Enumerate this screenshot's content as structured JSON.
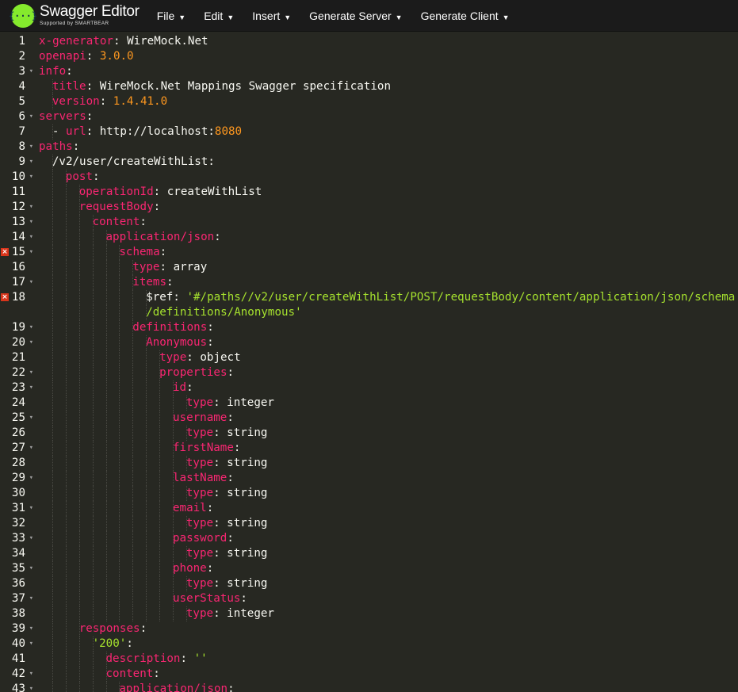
{
  "header": {
    "logo_title": "Swagger Editor",
    "logo_subtitle": "Supported by SMARTBEAR",
    "logo_icon": "{···}",
    "menu": [
      {
        "label": "File",
        "caret": "▼"
      },
      {
        "label": "Edit",
        "caret": "▼"
      },
      {
        "label": "Insert",
        "caret": "▼"
      },
      {
        "label": "Generate Server",
        "caret": "▼"
      },
      {
        "label": "Generate Client",
        "caret": "▼"
      }
    ]
  },
  "colors": {
    "accent": "#85ea2d",
    "key": "#f92672",
    "number": "#fd971f",
    "string": "#a6e22e",
    "text": "#f8f8f2",
    "error": "#d9351b"
  },
  "editor": {
    "lines": [
      {
        "n": "1",
        "fold": "",
        "err": false,
        "ind": 0,
        "tokens": [
          {
            "t": "k",
            "v": "x-generator"
          },
          {
            "t": "p",
            "v": ": "
          },
          {
            "t": "v",
            "v": "WireMock.Net"
          }
        ]
      },
      {
        "n": "2",
        "fold": "",
        "err": false,
        "ind": 0,
        "tokens": [
          {
            "t": "k",
            "v": "openapi"
          },
          {
            "t": "p",
            "v": ": "
          },
          {
            "t": "n",
            "v": "3.0.0"
          }
        ]
      },
      {
        "n": "3",
        "fold": "▾",
        "err": false,
        "ind": 0,
        "tokens": [
          {
            "t": "k",
            "v": "info"
          },
          {
            "t": "p",
            "v": ":"
          }
        ]
      },
      {
        "n": "4",
        "fold": "",
        "err": false,
        "ind": 1,
        "tokens": [
          {
            "t": "k",
            "v": "title"
          },
          {
            "t": "p",
            "v": ": "
          },
          {
            "t": "v",
            "v": "WireMock.Net Mappings Swagger specification"
          }
        ]
      },
      {
        "n": "5",
        "fold": "",
        "err": false,
        "ind": 1,
        "tokens": [
          {
            "t": "k",
            "v": "version"
          },
          {
            "t": "p",
            "v": ": "
          },
          {
            "t": "n",
            "v": "1.4.41.0"
          }
        ]
      },
      {
        "n": "6",
        "fold": "▾",
        "err": false,
        "ind": 0,
        "tokens": [
          {
            "t": "k",
            "v": "servers"
          },
          {
            "t": "p",
            "v": ":"
          }
        ]
      },
      {
        "n": "7",
        "fold": "",
        "err": false,
        "ind": 1,
        "tokens": [
          {
            "t": "p",
            "v": "- "
          },
          {
            "t": "k",
            "v": "url"
          },
          {
            "t": "p",
            "v": ": "
          },
          {
            "t": "v",
            "v": "http://localhost:"
          },
          {
            "t": "n",
            "v": "8080"
          }
        ]
      },
      {
        "n": "8",
        "fold": "▾",
        "err": false,
        "ind": 0,
        "tokens": [
          {
            "t": "k",
            "v": "paths"
          },
          {
            "t": "p",
            "v": ":"
          }
        ]
      },
      {
        "n": "9",
        "fold": "▾",
        "err": false,
        "ind": 1,
        "tokens": [
          {
            "t": "v",
            "v": "/v2/user/createWithList"
          },
          {
            "t": "p",
            "v": ":"
          }
        ]
      },
      {
        "n": "10",
        "fold": "▾",
        "err": false,
        "ind": 2,
        "tokens": [
          {
            "t": "k",
            "v": "post"
          },
          {
            "t": "p",
            "v": ":"
          }
        ]
      },
      {
        "n": "11",
        "fold": "",
        "err": false,
        "ind": 3,
        "tokens": [
          {
            "t": "k",
            "v": "operationId"
          },
          {
            "t": "p",
            "v": ": "
          },
          {
            "t": "v",
            "v": "createWithList"
          }
        ]
      },
      {
        "n": "12",
        "fold": "▾",
        "err": false,
        "ind": 3,
        "tokens": [
          {
            "t": "k",
            "v": "requestBody"
          },
          {
            "t": "p",
            "v": ":"
          }
        ]
      },
      {
        "n": "13",
        "fold": "▾",
        "err": false,
        "ind": 4,
        "tokens": [
          {
            "t": "k",
            "v": "content"
          },
          {
            "t": "p",
            "v": ":"
          }
        ]
      },
      {
        "n": "14",
        "fold": "▾",
        "err": false,
        "ind": 5,
        "tokens": [
          {
            "t": "k",
            "v": "application/json"
          },
          {
            "t": "p",
            "v": ":"
          }
        ]
      },
      {
        "n": "15",
        "fold": "▾",
        "err": true,
        "ind": 6,
        "tokens": [
          {
            "t": "k",
            "v": "schema"
          },
          {
            "t": "p",
            "v": ":"
          }
        ]
      },
      {
        "n": "16",
        "fold": "",
        "err": false,
        "ind": 7,
        "tokens": [
          {
            "t": "k",
            "v": "type"
          },
          {
            "t": "p",
            "v": ": "
          },
          {
            "t": "v",
            "v": "array"
          }
        ]
      },
      {
        "n": "17",
        "fold": "▾",
        "err": false,
        "ind": 7,
        "tokens": [
          {
            "t": "k",
            "v": "items"
          },
          {
            "t": "p",
            "v": ":"
          }
        ]
      },
      {
        "n": "18",
        "fold": "",
        "err": true,
        "ind": 8,
        "tokens": [
          {
            "t": "v",
            "v": "$ref"
          },
          {
            "t": "p",
            "v": ": "
          },
          {
            "t": "s",
            "v": "'#/paths//v2/user/createWithList/POST/requestBody/content/application/json/schema"
          }
        ]
      },
      {
        "n": "",
        "fold": "",
        "err": false,
        "ind": 8,
        "wrap": true,
        "tokens": [
          {
            "t": "s",
            "v": "/definitions/Anonymous'"
          }
        ]
      },
      {
        "n": "19",
        "fold": "▾",
        "err": false,
        "ind": 7,
        "tokens": [
          {
            "t": "k",
            "v": "definitions"
          },
          {
            "t": "p",
            "v": ":"
          }
        ]
      },
      {
        "n": "20",
        "fold": "▾",
        "err": false,
        "ind": 8,
        "tokens": [
          {
            "t": "k",
            "v": "Anonymous"
          },
          {
            "t": "p",
            "v": ":"
          }
        ]
      },
      {
        "n": "21",
        "fold": "",
        "err": false,
        "ind": 9,
        "tokens": [
          {
            "t": "k",
            "v": "type"
          },
          {
            "t": "p",
            "v": ": "
          },
          {
            "t": "v",
            "v": "object"
          }
        ]
      },
      {
        "n": "22",
        "fold": "▾",
        "err": false,
        "ind": 9,
        "tokens": [
          {
            "t": "k",
            "v": "properties"
          },
          {
            "t": "p",
            "v": ":"
          }
        ]
      },
      {
        "n": "23",
        "fold": "▾",
        "err": false,
        "ind": 10,
        "tokens": [
          {
            "t": "k",
            "v": "id"
          },
          {
            "t": "p",
            "v": ":"
          }
        ]
      },
      {
        "n": "24",
        "fold": "",
        "err": false,
        "ind": 11,
        "tokens": [
          {
            "t": "k",
            "v": "type"
          },
          {
            "t": "p",
            "v": ": "
          },
          {
            "t": "v",
            "v": "integer"
          }
        ]
      },
      {
        "n": "25",
        "fold": "▾",
        "err": false,
        "ind": 10,
        "tokens": [
          {
            "t": "k",
            "v": "username"
          },
          {
            "t": "p",
            "v": ":"
          }
        ]
      },
      {
        "n": "26",
        "fold": "",
        "err": false,
        "ind": 11,
        "tokens": [
          {
            "t": "k",
            "v": "type"
          },
          {
            "t": "p",
            "v": ": "
          },
          {
            "t": "v",
            "v": "string"
          }
        ]
      },
      {
        "n": "27",
        "fold": "▾",
        "err": false,
        "ind": 10,
        "tokens": [
          {
            "t": "k",
            "v": "firstName"
          },
          {
            "t": "p",
            "v": ":"
          }
        ]
      },
      {
        "n": "28",
        "fold": "",
        "err": false,
        "ind": 11,
        "tokens": [
          {
            "t": "k",
            "v": "type"
          },
          {
            "t": "p",
            "v": ": "
          },
          {
            "t": "v",
            "v": "string"
          }
        ]
      },
      {
        "n": "29",
        "fold": "▾",
        "err": false,
        "ind": 10,
        "tokens": [
          {
            "t": "k",
            "v": "lastName"
          },
          {
            "t": "p",
            "v": ":"
          }
        ]
      },
      {
        "n": "30",
        "fold": "",
        "err": false,
        "ind": 11,
        "tokens": [
          {
            "t": "k",
            "v": "type"
          },
          {
            "t": "p",
            "v": ": "
          },
          {
            "t": "v",
            "v": "string"
          }
        ]
      },
      {
        "n": "31",
        "fold": "▾",
        "err": false,
        "ind": 10,
        "tokens": [
          {
            "t": "k",
            "v": "email"
          },
          {
            "t": "p",
            "v": ":"
          }
        ]
      },
      {
        "n": "32",
        "fold": "",
        "err": false,
        "ind": 11,
        "tokens": [
          {
            "t": "k",
            "v": "type"
          },
          {
            "t": "p",
            "v": ": "
          },
          {
            "t": "v",
            "v": "string"
          }
        ]
      },
      {
        "n": "33",
        "fold": "▾",
        "err": false,
        "ind": 10,
        "tokens": [
          {
            "t": "k",
            "v": "password"
          },
          {
            "t": "p",
            "v": ":"
          }
        ]
      },
      {
        "n": "34",
        "fold": "",
        "err": false,
        "ind": 11,
        "tokens": [
          {
            "t": "k",
            "v": "type"
          },
          {
            "t": "p",
            "v": ": "
          },
          {
            "t": "v",
            "v": "string"
          }
        ]
      },
      {
        "n": "35",
        "fold": "▾",
        "err": false,
        "ind": 10,
        "tokens": [
          {
            "t": "k",
            "v": "phone"
          },
          {
            "t": "p",
            "v": ":"
          }
        ]
      },
      {
        "n": "36",
        "fold": "",
        "err": false,
        "ind": 11,
        "tokens": [
          {
            "t": "k",
            "v": "type"
          },
          {
            "t": "p",
            "v": ": "
          },
          {
            "t": "v",
            "v": "string"
          }
        ]
      },
      {
        "n": "37",
        "fold": "▾",
        "err": false,
        "ind": 10,
        "tokens": [
          {
            "t": "k",
            "v": "userStatus"
          },
          {
            "t": "p",
            "v": ":"
          }
        ]
      },
      {
        "n": "38",
        "fold": "",
        "err": false,
        "ind": 11,
        "tokens": [
          {
            "t": "k",
            "v": "type"
          },
          {
            "t": "p",
            "v": ": "
          },
          {
            "t": "v",
            "v": "integer"
          }
        ]
      },
      {
        "n": "39",
        "fold": "▾",
        "err": false,
        "ind": 3,
        "tokens": [
          {
            "t": "k",
            "v": "responses"
          },
          {
            "t": "p",
            "v": ":"
          }
        ]
      },
      {
        "n": "40",
        "fold": "▾",
        "err": false,
        "ind": 4,
        "tokens": [
          {
            "t": "s",
            "v": "'200'"
          },
          {
            "t": "p",
            "v": ":"
          }
        ]
      },
      {
        "n": "41",
        "fold": "",
        "err": false,
        "ind": 5,
        "tokens": [
          {
            "t": "k",
            "v": "description"
          },
          {
            "t": "p",
            "v": ": "
          },
          {
            "t": "s",
            "v": "''"
          }
        ]
      },
      {
        "n": "42",
        "fold": "▾",
        "err": false,
        "ind": 5,
        "tokens": [
          {
            "t": "k",
            "v": "content"
          },
          {
            "t": "p",
            "v": ":"
          }
        ]
      },
      {
        "n": "43",
        "fold": "▾",
        "err": false,
        "ind": 6,
        "tokens": [
          {
            "t": "k",
            "v": "application/json"
          },
          {
            "t": "p",
            "v": ":"
          }
        ]
      }
    ]
  }
}
